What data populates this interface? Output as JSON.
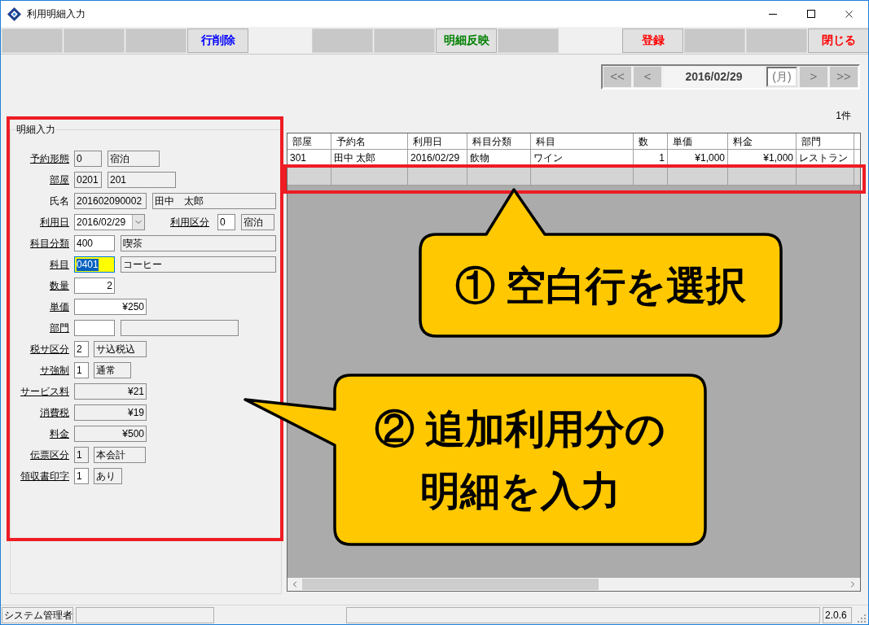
{
  "window": {
    "title": "利用明細入力"
  },
  "toolbar": {
    "groups": [
      [
        {
          "kind": "blank"
        },
        {
          "kind": "blank"
        },
        {
          "kind": "blank"
        },
        {
          "kind": "button",
          "label": "行削除",
          "color": "#0000ff"
        }
      ],
      [
        {
          "kind": "blank"
        },
        {
          "kind": "blank"
        },
        {
          "kind": "button",
          "label": "明細反映",
          "color": "#008000"
        },
        {
          "kind": "blank"
        }
      ],
      [
        {
          "kind": "button",
          "label": "登録",
          "color": "#ff0000"
        },
        {
          "kind": "blank"
        },
        {
          "kind": "blank"
        },
        {
          "kind": "button",
          "label": "閉じる",
          "color": "#ff0000"
        }
      ]
    ]
  },
  "date_nav": {
    "prev_buttons": [
      "<<",
      "<"
    ],
    "date": "2016/02/29",
    "weekday": "(月)",
    "next_buttons": [
      ">",
      ">>"
    ]
  },
  "detail_form": {
    "title": "明細入力",
    "rows": [
      {
        "label": "予約形態",
        "link": true,
        "items": [
          {
            "kind": "text",
            "value": "0",
            "readonly": true,
            "focused": false
          },
          {
            "kind": "text",
            "value": "宿泊",
            "readonly": true,
            "focused": false
          }
        ]
      },
      {
        "label": "部屋",
        "link": true,
        "items": [
          {
            "kind": "text",
            "value": "0201",
            "readonly": true,
            "focused": false
          },
          {
            "kind": "text",
            "value": "201",
            "readonly": true,
            "focused": false
          }
        ]
      },
      {
        "label": "氏名",
        "link": false,
        "items": [
          {
            "kind": "text",
            "value": "201602090002",
            "readonly": true,
            "focused": false
          },
          {
            "kind": "text",
            "value": "田中　太郎",
            "readonly": true,
            "focused": false
          }
        ]
      },
      {
        "label": "利用日",
        "link": true,
        "items": [
          {
            "kind": "date",
            "value": "2016/02/29",
            "readonly": false,
            "focused": false
          },
          {
            "kind": "label",
            "text": "利用区分",
            "link": true
          },
          {
            "kind": "text",
            "value": "0",
            "readonly": false,
            "focused": false
          },
          {
            "kind": "text",
            "value": "宿泊",
            "readonly": true,
            "focused": false
          }
        ]
      },
      {
        "label": "科目分類",
        "link": true,
        "items": [
          {
            "kind": "text",
            "value": "400",
            "readonly": false,
            "focused": false
          },
          {
            "kind": "text",
            "value": "喫茶",
            "readonly": true,
            "focused": false
          }
        ]
      },
      {
        "label": "科目",
        "link": true,
        "items": [
          {
            "kind": "text",
            "value": "0401",
            "readonly": false,
            "focused": true
          },
          {
            "kind": "text",
            "value": "コーヒー",
            "readonly": true,
            "focused": false
          }
        ]
      },
      {
        "label": "数量",
        "link": true,
        "items": [
          {
            "kind": "number",
            "value": "2",
            "readonly": false,
            "focused": false
          }
        ]
      },
      {
        "label": "単価",
        "link": true,
        "items": [
          {
            "kind": "number",
            "value": "¥250",
            "readonly": false,
            "focused": false
          }
        ]
      },
      {
        "label": "部門",
        "link": true,
        "items": [
          {
            "kind": "text",
            "readonly": false,
            "focused": false
          },
          {
            "kind": "text",
            "readonly": true,
            "focused": false
          }
        ]
      },
      {
        "label": "税サ区分",
        "link": true,
        "items": [
          {
            "kind": "text",
            "value": "2",
            "readonly": false,
            "focused": false
          },
          {
            "kind": "text",
            "value": "サ込税込",
            "readonly": true,
            "focused": false
          }
        ]
      },
      {
        "label": "サ強制",
        "link": true,
        "items": [
          {
            "kind": "text",
            "value": "1",
            "readonly": false,
            "focused": false
          },
          {
            "kind": "text",
            "value": "通常",
            "readonly": true,
            "focused": false
          }
        ]
      },
      {
        "label": "サービス料",
        "link": true,
        "items": [
          {
            "kind": "number",
            "value": "¥21",
            "readonly": true,
            "focused": false
          }
        ]
      },
      {
        "label": "消費税",
        "link": true,
        "items": [
          {
            "kind": "number",
            "value": "¥19",
            "readonly": true,
            "focused": false
          }
        ]
      },
      {
        "label": "料金",
        "link": true,
        "items": [
          {
            "kind": "number",
            "value": "¥500",
            "readonly": true,
            "focused": false
          }
        ]
      },
      {
        "label": "伝票区分",
        "link": true,
        "items": [
          {
            "kind": "text",
            "value": "1",
            "readonly": true,
            "focused": false
          },
          {
            "kind": "text",
            "value": "本会計",
            "readonly": true,
            "focused": false
          }
        ]
      },
      {
        "label": "領収書印字",
        "link": true,
        "items": [
          {
            "kind": "text",
            "value": "1",
            "readonly": false,
            "focused": false
          },
          {
            "kind": "text",
            "value": "あり",
            "readonly": true,
            "focused": false
          }
        ]
      }
    ]
  },
  "record_count": "1件",
  "table": {
    "columns": [
      {
        "label": "部屋",
        "kind": "text"
      },
      {
        "label": "予約名",
        "kind": "text"
      },
      {
        "label": "利用日",
        "kind": "text"
      },
      {
        "label": "科目分類",
        "kind": "text"
      },
      {
        "label": "科目",
        "kind": "text"
      },
      {
        "label": "数",
        "kind": "number"
      },
      {
        "label": "単価",
        "kind": "number"
      },
      {
        "label": "料金",
        "kind": "number"
      },
      {
        "label": "部門",
        "kind": "text"
      }
    ],
    "rows": [
      {
        "kind": "data",
        "cells": [
          "301",
          "田中 太郎",
          "2016/02/29",
          "飲物",
          "ワイン",
          "1",
          "¥1,000",
          "¥1,000",
          "レストラン"
        ]
      },
      {
        "kind": "new"
      }
    ]
  },
  "status_bar": {
    "user": "システム管理者",
    "version": "2.0.6"
  },
  "callouts": [
    {
      "lines": [
        "① 空白行を選択"
      ]
    },
    {
      "lines": [
        "② 追加利用分の",
        "明細を入力"
      ]
    }
  ]
}
